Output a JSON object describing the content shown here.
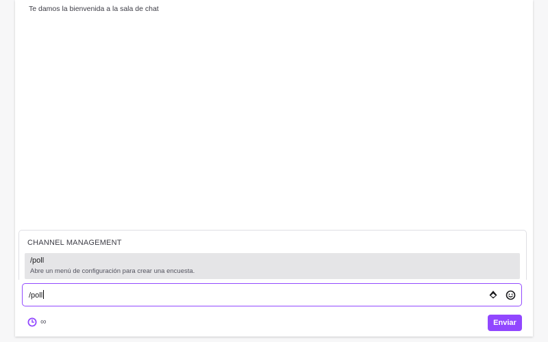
{
  "chat": {
    "welcome_message": "Te damos la bienvenida a la sala de chat"
  },
  "suggestions": {
    "header": "CHANNEL MANAGEMENT",
    "items": [
      {
        "command": "/poll",
        "description": "Abre un menú de configuración para crear una encuesta."
      }
    ]
  },
  "input": {
    "value": "/poll"
  },
  "footer": {
    "slow_mode_value": "∞",
    "send_label": "Enviar"
  },
  "icons": {
    "bits": "bits-icon",
    "emote": "emote-icon",
    "clock": "clock-icon"
  },
  "colors": {
    "accent": "#9147ff",
    "highlight": "#e5e5e7"
  }
}
